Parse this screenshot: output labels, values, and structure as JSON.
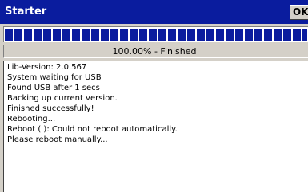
{
  "window": {
    "title": "Starter",
    "ok_label": "OK"
  },
  "progress": {
    "fraction": 1.0,
    "status_text": "100.00% - Finished"
  },
  "log": {
    "lines": [
      "Lib-Version: 2.0.567",
      "System waiting for USB",
      "Found USB after 1 secs",
      "Backing up current version.",
      "Finished successfully!",
      "Rebooting...",
      "Reboot (  ): Could not reboot automatically.",
      "Please reboot manually..."
    ]
  },
  "colors": {
    "titlebar": "#0a1c9e",
    "progress_fill": "#0a1c9e",
    "panel_background": "#d4d0c8"
  }
}
